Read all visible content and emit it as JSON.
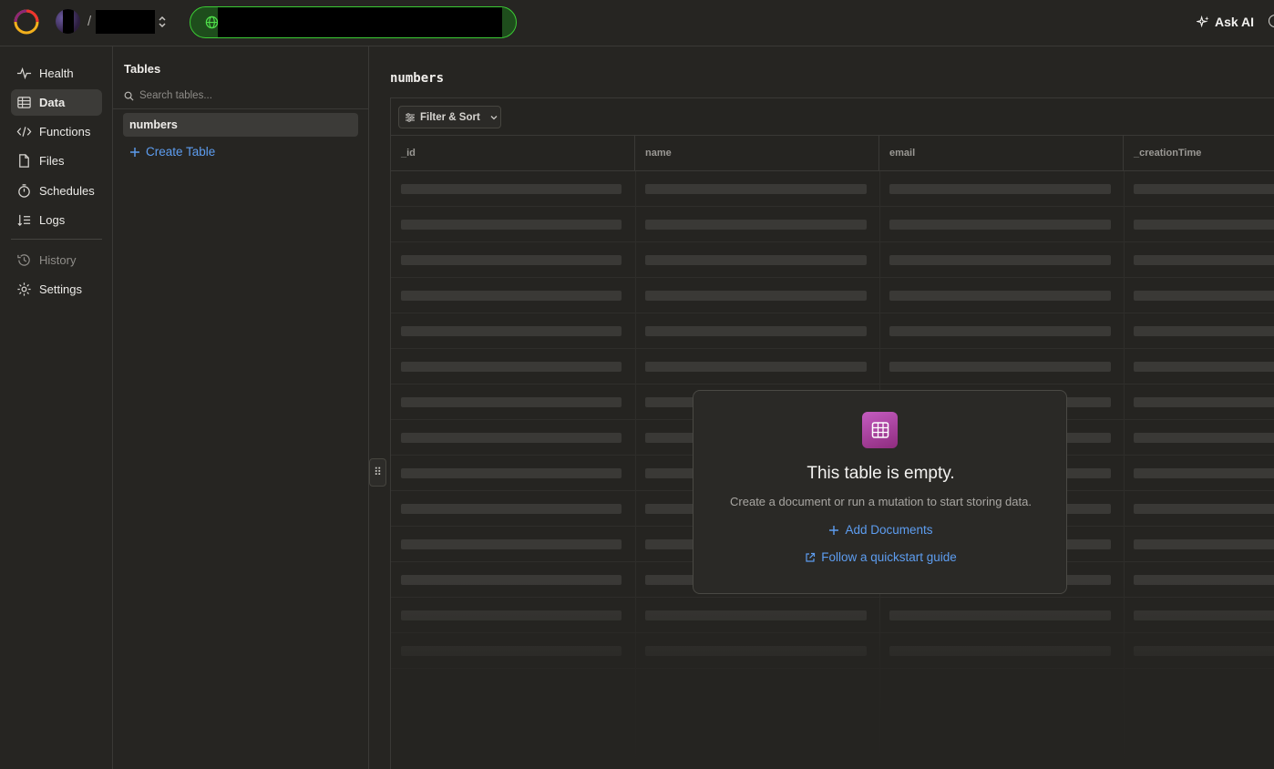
{
  "topbar": {
    "breadcrumb_separator": "/",
    "ask_ai_label": "Ask AI"
  },
  "nav": {
    "items": [
      {
        "label": "Health",
        "icon": "pulse-icon"
      },
      {
        "label": "Data",
        "icon": "table-icon",
        "active": true
      },
      {
        "label": "Functions",
        "icon": "code-icon"
      },
      {
        "label": "Files",
        "icon": "file-icon"
      },
      {
        "label": "Schedules",
        "icon": "stopwatch-icon"
      },
      {
        "label": "Logs",
        "icon": "logs-icon"
      },
      {
        "label": "History",
        "icon": "history-icon",
        "muted": true
      },
      {
        "label": "Settings",
        "icon": "gear-icon"
      }
    ]
  },
  "tables_panel": {
    "title": "Tables",
    "search_placeholder": "Search tables...",
    "tables": [
      "numbers"
    ],
    "create_label": "Create Table"
  },
  "main": {
    "table_name": "numbers",
    "filter_sort_label": "Filter & Sort",
    "columns": [
      "_id",
      "name",
      "email",
      "_creationTime"
    ],
    "placeholder_rows": 14
  },
  "empty_state": {
    "title": "This table is empty.",
    "subtitle": "Create a document or run a mutation to start storing data.",
    "add_documents_label": "Add Documents",
    "quickstart_label": "Follow a quickstart guide"
  },
  "colors": {
    "accent_link": "#5d9df0",
    "deployment_green": "#3bcc34",
    "empty_icon_gradient": [
      "#c45cc0",
      "#8e2c7e"
    ]
  }
}
